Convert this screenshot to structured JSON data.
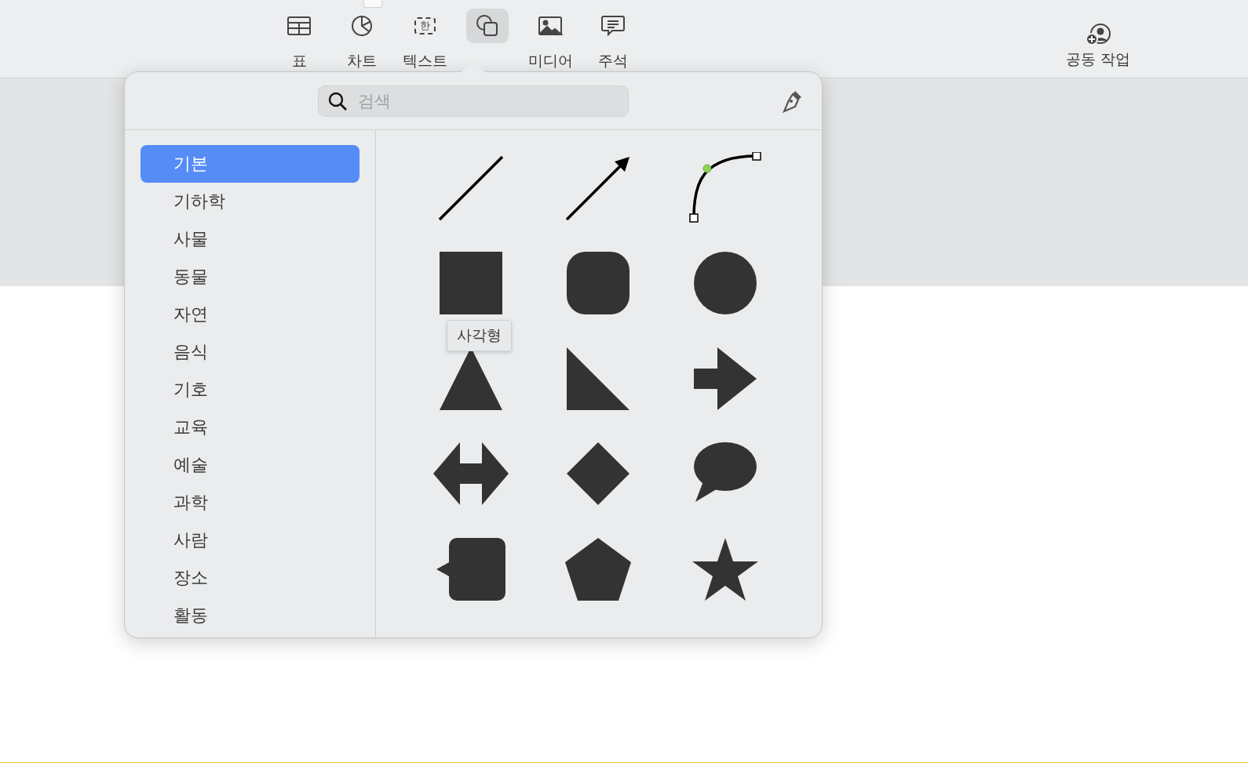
{
  "toolbar": {
    "items": [
      {
        "kind": "table",
        "label": "표",
        "selected": false
      },
      {
        "kind": "chart",
        "label": "차트",
        "selected": false
      },
      {
        "kind": "text",
        "label": "텍스트",
        "glyph": "한",
        "selected": false
      },
      {
        "kind": "shape",
        "selected": true
      },
      {
        "kind": "media",
        "label": "미디어",
        "selected": false
      },
      {
        "kind": "comment",
        "label": "주석",
        "selected": false
      }
    ],
    "collaborate": {
      "label": "공동 작업"
    }
  },
  "shapes_popover": {
    "search": {
      "placeholder": "검색"
    },
    "categories": [
      {
        "label": "기본",
        "selected": true
      },
      {
        "label": "기하학",
        "selected": false
      },
      {
        "label": "사물",
        "selected": false
      },
      {
        "label": "동물",
        "selected": false
      },
      {
        "label": "자연",
        "selected": false
      },
      {
        "label": "음식",
        "selected": false
      },
      {
        "label": "기호",
        "selected": false
      },
      {
        "label": "교육",
        "selected": false
      },
      {
        "label": "예술",
        "selected": false
      },
      {
        "label": "과학",
        "selected": false
      },
      {
        "label": "사람",
        "selected": false
      },
      {
        "label": "장소",
        "selected": false
      },
      {
        "label": "활동",
        "selected": false
      }
    ],
    "shapes": [
      {
        "kind": "line"
      },
      {
        "kind": "arrow"
      },
      {
        "kind": "curve"
      },
      {
        "kind": "square",
        "tooltip": "사각형"
      },
      {
        "kind": "rounded-square"
      },
      {
        "kind": "circle"
      },
      {
        "kind": "triangle"
      },
      {
        "kind": "right-triangle"
      },
      {
        "kind": "arrow-shape"
      },
      {
        "kind": "double-arrow"
      },
      {
        "kind": "diamond"
      },
      {
        "kind": "speech-bubble"
      },
      {
        "kind": "callout"
      },
      {
        "kind": "pentagon"
      },
      {
        "kind": "star"
      }
    ]
  }
}
